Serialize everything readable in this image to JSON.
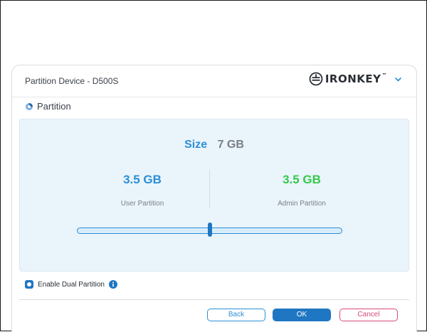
{
  "window": {
    "title": "Partition Device - D500S",
    "brand": "IRONKEY",
    "brand_tm": "™"
  },
  "section": {
    "title": "Partition"
  },
  "size": {
    "label": "Size",
    "value": "7 GB"
  },
  "partitions": {
    "user": {
      "value": "3.5 GB",
      "label": "User Partition"
    },
    "admin": {
      "value": "3.5 GB",
      "label": "Admin Partition"
    }
  },
  "slider": {
    "position_fraction": 0.5
  },
  "options": {
    "enable_dual_partition_label": "Enable Dual Partition",
    "enable_dual_partition_checked": true
  },
  "buttons": {
    "back": "Back",
    "ok": "OK",
    "cancel": "Cancel"
  },
  "colors": {
    "accent_blue": "#2a8fd6",
    "admin_green": "#35c94a",
    "cancel_pink": "#d64a73",
    "primary_button": "#1f76c2"
  },
  "icons": {
    "brand": "ironkey-logo-icon",
    "menu": "chevron-down-icon",
    "section": "partition-icon",
    "info": "info-icon",
    "checkbox": "checkbox-checked-icon"
  }
}
